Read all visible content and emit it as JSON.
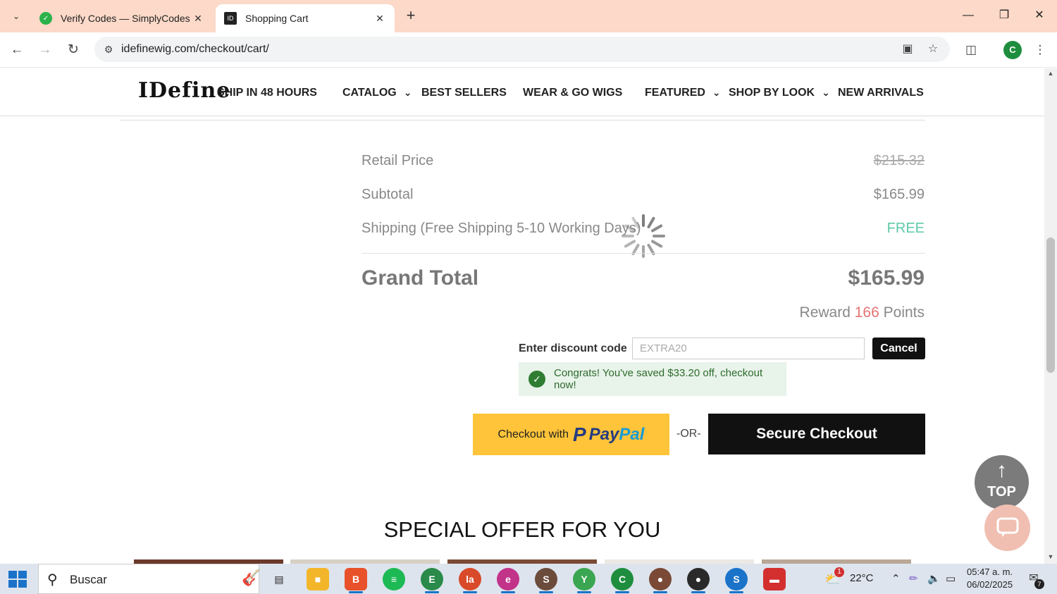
{
  "browser": {
    "tabs": [
      {
        "title": "Verify Codes — SimplyCodes",
        "favicon": "simplycodes-icon"
      },
      {
        "title": "Shopping Cart",
        "favicon": "idefine-icon"
      }
    ],
    "url": "idefinewig.com/checkout/cart/",
    "profile_initial": "C"
  },
  "site": {
    "logo": "IDefine",
    "nav": [
      "SHIP IN 48 HOURS",
      "CATALOG",
      "BEST SELLERS",
      "WEAR & GO WIGS",
      "FEATURED",
      "SHOP BY LOOK",
      "NEW ARRIVALS"
    ]
  },
  "summary": {
    "retail_label": "Retail Price",
    "retail_value": "$215.32",
    "subtotal_label": "Subtotal",
    "subtotal_value": "$165.99",
    "shipping_label": "Shipping (Free Shipping 5-10 Working Days)",
    "shipping_value": "FREE",
    "grand_label": "Grand Total",
    "grand_value": "$165.99",
    "reward_prefix": "Reward ",
    "reward_points": "166",
    "reward_suffix": " Points"
  },
  "discount": {
    "label": "Enter discount code",
    "value": "EXTRA20",
    "cancel_label": "Cancel",
    "message": "Congrats! You've saved $33.20 off, checkout now!"
  },
  "checkout": {
    "paypal_prefix": "Checkout with",
    "paypal_word_a": "Pay",
    "paypal_word_b": "Pal",
    "or_text": "-OR-",
    "secure_label": "Secure Checkout"
  },
  "special_offer_title": "SPECIAL OFFER FOR YOU",
  "floating": {
    "top_label": "TOP"
  },
  "taskbar": {
    "search_placeholder": "Buscar",
    "weather": "22°C",
    "time": "05:47 a. m.",
    "date": "06/02/2025",
    "notification_badge": "1",
    "notification_count": "7"
  },
  "colors": {
    "free_green": "#5fc9a8",
    "points_red": "#e57373",
    "paypal_yellow": "#ffc439",
    "congrats_bg": "#e8f3ea"
  }
}
